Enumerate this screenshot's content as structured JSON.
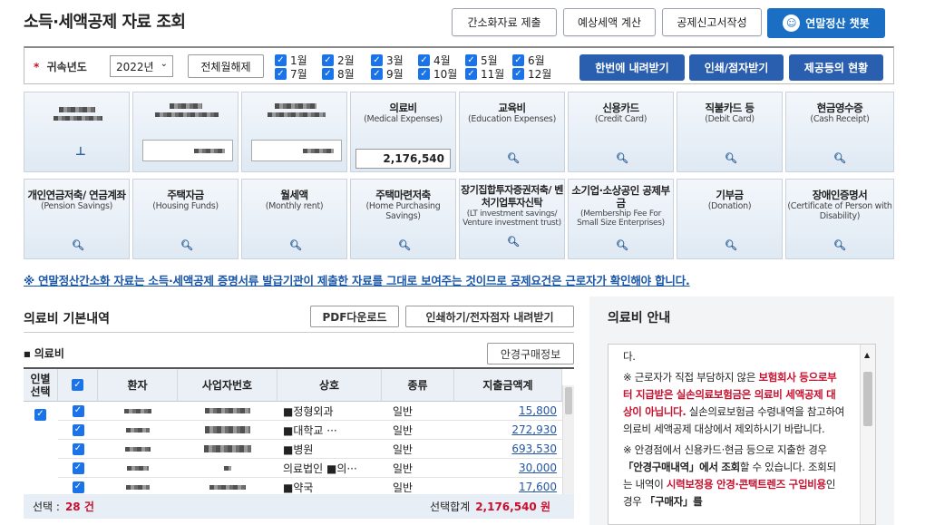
{
  "header": {
    "title": "소득·세액공제 자료 조회",
    "buttons": [
      "간소화자료 제출",
      "예상세액 계산",
      "공제신고서작성"
    ],
    "chatbot": "연말정산 챗봇"
  },
  "filter": {
    "required_mark": "*",
    "year_label": "귀속년도",
    "year_value": "2022년",
    "clear_all": "전체월해제",
    "months_row1": [
      "1월",
      "2월",
      "3월",
      "4월",
      "5월",
      "6월"
    ],
    "months_row2": [
      "7월",
      "8월",
      "9월",
      "10월",
      "11월",
      "12월"
    ],
    "actions": [
      "한번에 내려받기",
      "인쇄/점자받기",
      "제공등의 현황"
    ]
  },
  "tiles_row1": [
    {
      "title": "의료비",
      "sub": "(Medical Expenses)",
      "amount": "2,176,540"
    },
    {
      "title": "교육비",
      "sub": "(Education Expenses)"
    },
    {
      "title": "신용카드",
      "sub": "(Credit Card)"
    },
    {
      "title": "직불카드 등",
      "sub": "(Debit Card)"
    },
    {
      "title": "현금영수증",
      "sub": "(Cash Receipt)"
    }
  ],
  "tiles_row2": [
    {
      "title": "개인연금저축/ 연금계좌",
      "sub": "(Pension Savings)"
    },
    {
      "title": "주택자금",
      "sub": "(Housing Funds)"
    },
    {
      "title": "월세액",
      "sub": "(Monthly rent)"
    },
    {
      "title": "주택마련저축",
      "sub": "(Home Purchasing Savings)"
    },
    {
      "title": "장기집합투자증권저축/ 벤처기업투자신탁",
      "sub": "(LT investment savings/ Venture investment trust)"
    },
    {
      "title": "소기업·소상공인 공제부금",
      "sub": "(Membership Fee For Small Size Enterprises)"
    },
    {
      "title": "기부금",
      "sub": "(Donation)"
    },
    {
      "title": "장애인증명서",
      "sub": "(Certificate of Person with Disability)"
    }
  ],
  "notice": "※ 연말정산간소화 자료는 소득·세액공제 증명서류 발급기관이 제출한 자료를 그대로 보여주는 것이므로 공제요건은 근로자가 확인해야 합니다.",
  "detail": {
    "title": "의료비 기본내역",
    "pdf": "PDF다운로드",
    "print": "인쇄하기/전자점자 내려받기",
    "subtitle": "의료비",
    "glasses": "안경구매정보",
    "columns": [
      "인별 선택",
      "환자",
      "사업자번호",
      "상호",
      "종류",
      "지출금액계"
    ],
    "rows": [
      {
        "name": "■정형외과",
        "type": "일반",
        "amount": "15,800"
      },
      {
        "name": "■대학교 ···",
        "type": "일반",
        "amount": "272,930"
      },
      {
        "name": "■병원",
        "type": "일반",
        "amount": "693,530"
      },
      {
        "name": "의료법인 ■의···",
        "type": "일반",
        "amount": "30,000"
      },
      {
        "name": "■약국",
        "type": "일반",
        "amount": "17,600"
      }
    ],
    "footer_sel_label": "선택 :",
    "footer_sel_value": "28 건",
    "footer_sum_label": "선택합계",
    "footer_sum_value": "2,176,540 원"
  },
  "guide": {
    "title": "의료비 안내",
    "p0": "다.",
    "p1a": "※ 근로자가 직접 부담하지 않은 ",
    "p1b": "보험회사 등으로부터 지급받은 실손의료보험금은 의료비 세액공제 대상이 아닙니다.",
    "p1c": " 실손의료보험금 수령내역을 참고하여 의료비 세액공제 대상에서 제외하시기 바랍니다.",
    "p2a": "※ 안경점에서 신용카드·현금 등으로 지출한 경우 ",
    "p2b": "「안경구매내역」에서 조회",
    "p2c": "할 수 있습니다. 조회되는 내역이 ",
    "p2d": "시력보정용 안경·콘택트렌즈 구입비용",
    "p2e": "인 경우 ",
    "p2f": "「구매자」를"
  },
  "colors": {
    "accent": "#1a6fc4",
    "action": "#2a5fb0",
    "notice": "#1a56a8",
    "warn": "#c8102e"
  }
}
